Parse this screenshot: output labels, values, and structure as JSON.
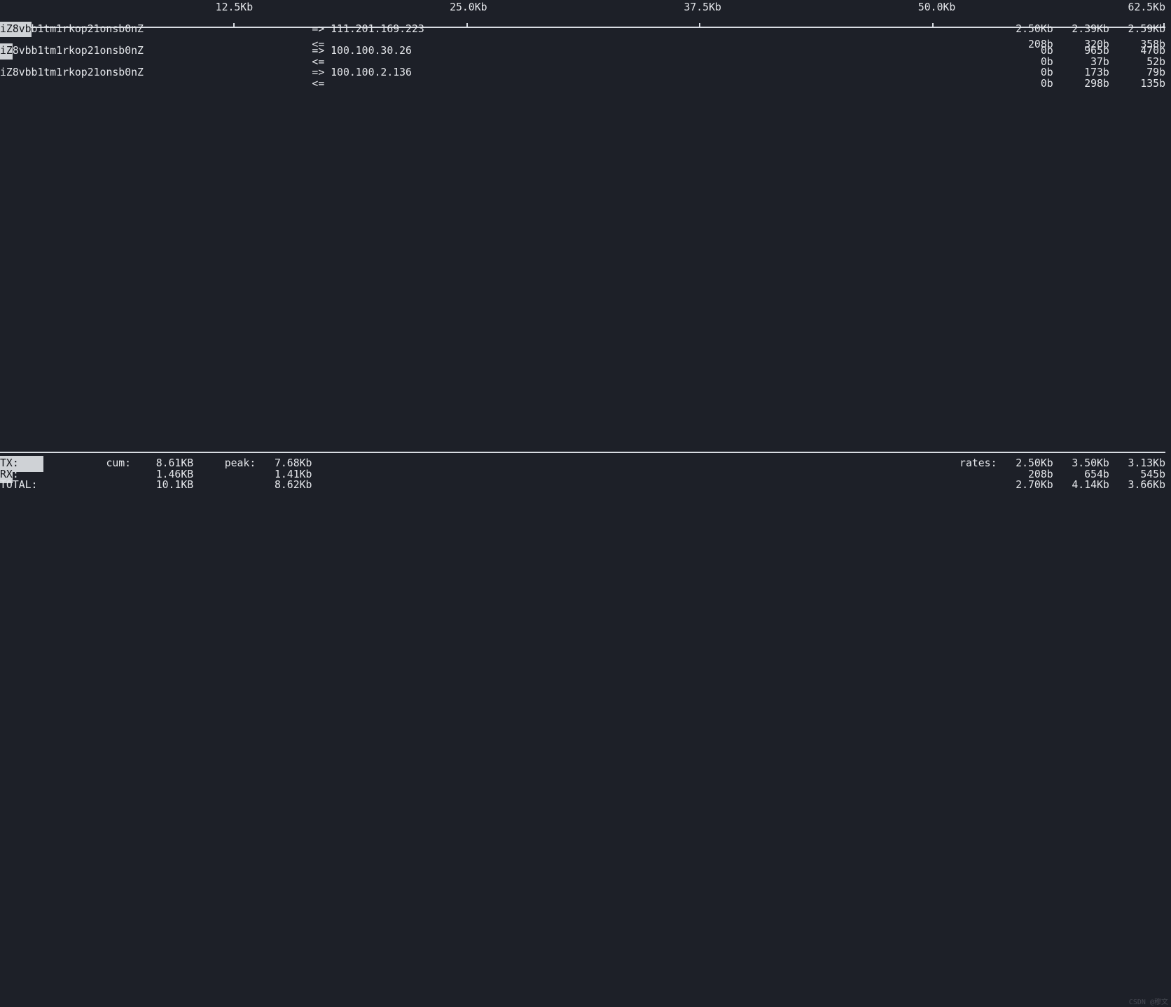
{
  "scale": {
    "ticks": [
      {
        "label": "12.5Kb",
        "pos": 0.2
      },
      {
        "label": "25.0Kb",
        "pos": 0.4
      },
      {
        "label": "37.5Kb",
        "pos": 0.6
      },
      {
        "label": "50.0Kb",
        "pos": 0.8
      },
      {
        "label": "62.5Kb",
        "pos": 1.0
      }
    ]
  },
  "connections": [
    {
      "src_prefix": "iZ8vb",
      "src_rest": "b1tm1rkop21onsb0nZ",
      "arrow_tx": "=>",
      "dst": "111.201.169.223",
      "arrow_rx": "<=",
      "tx": {
        "c2": "2.50Kb",
        "c10": "2.39Kb",
        "c40": "2.59Kb"
      },
      "rx": {
        "c2": "208b",
        "c10": "320b",
        "c40": "358b"
      }
    },
    {
      "src_prefix": "iZ",
      "src_rest": "8vbb1tm1rkop21onsb0nZ",
      "arrow_tx": "=>",
      "dst": "100.100.30.26",
      "arrow_rx": "<=",
      "tx": {
        "c2": "0b",
        "c10": "965b",
        "c40": "470b"
      },
      "rx": {
        "c2": "0b",
        "c10": "37b",
        "c40": "52b"
      }
    },
    {
      "src_prefix": "",
      "src_rest": "iZ8vbb1tm1rkop21onsb0nZ",
      "arrow_tx": "=>",
      "dst": "100.100.2.136",
      "arrow_rx": "<=",
      "tx": {
        "c2": "0b",
        "c10": "173b",
        "c40": "79b"
      },
      "rx": {
        "c2": "0b",
        "c10": "298b",
        "c40": "135b"
      }
    }
  ],
  "summary": {
    "labels": {
      "cum": "cum:",
      "peak": "peak:",
      "rates": "rates:"
    },
    "rows": [
      {
        "name": "TX:",
        "hl_after": true,
        "cum": "8.61KB",
        "peak": "7.68Kb",
        "r2": "2.50Kb",
        "r10": "3.50Kb",
        "r40": "3.13Kb"
      },
      {
        "name": "RX",
        "hl_colon": true,
        "cum": "1.46KB",
        "peak": "1.41Kb",
        "r2": "208b",
        "r10": "654b",
        "r40": "545b"
      },
      {
        "name": "TOTAL:",
        "cum": "10.1KB",
        "peak": "8.62Kb",
        "r2": "2.70Kb",
        "r10": "4.14Kb",
        "r40": "3.66Kb"
      }
    ]
  },
  "watermark": "CSDN @穆文"
}
